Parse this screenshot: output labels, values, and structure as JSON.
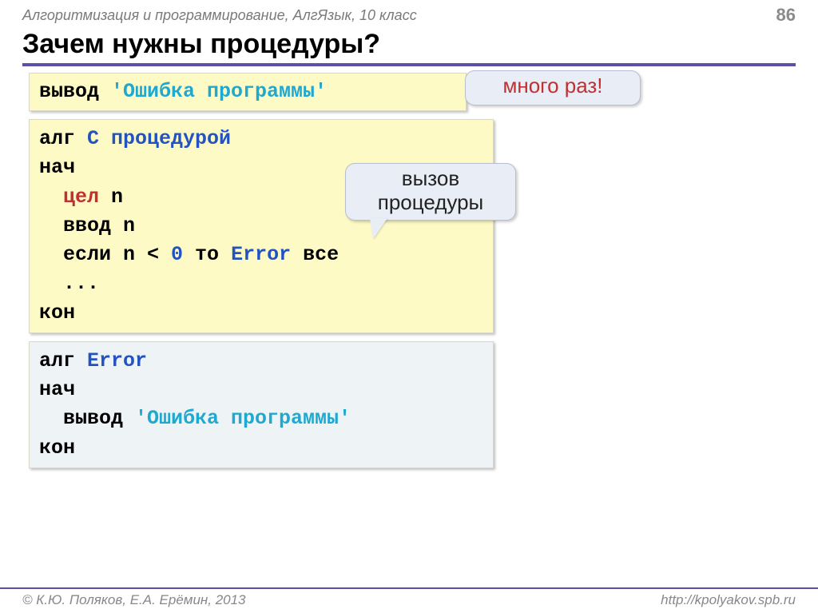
{
  "header": {
    "course": "Алгоритмизация и программирование, АлгЯзык, 10 класс",
    "page": "86"
  },
  "title": "Зачем нужны процедуры?",
  "box1": {
    "kw": "вывод ",
    "str": "'Ошибка программы'"
  },
  "callout1": "много раз!",
  "callout2_l1": "вызов",
  "callout2_l2": "процедуры",
  "box2": {
    "l1_kw": "алг ",
    "l1_id": "С процедурой",
    "l2": "нач",
    "l3_type": "цел",
    "l3_var": " n",
    "l4": "ввод n",
    "l5_a": "если n < ",
    "l5_num": "0",
    "l5_b": " то ",
    "l5_id": "Error",
    "l5_c": " все",
    "l6": "...",
    "l7": "кон"
  },
  "box3": {
    "l1_kw": "алг ",
    "l1_id": "Error",
    "l2": "нач",
    "l3_kw": "вывод ",
    "l3_str": "'Ошибка программы'",
    "l4": "кон"
  },
  "footer": {
    "left": "© К.Ю. Поляков, Е.А. Ерёмин, 2013",
    "right": "http://kpolyakov.spb.ru"
  }
}
